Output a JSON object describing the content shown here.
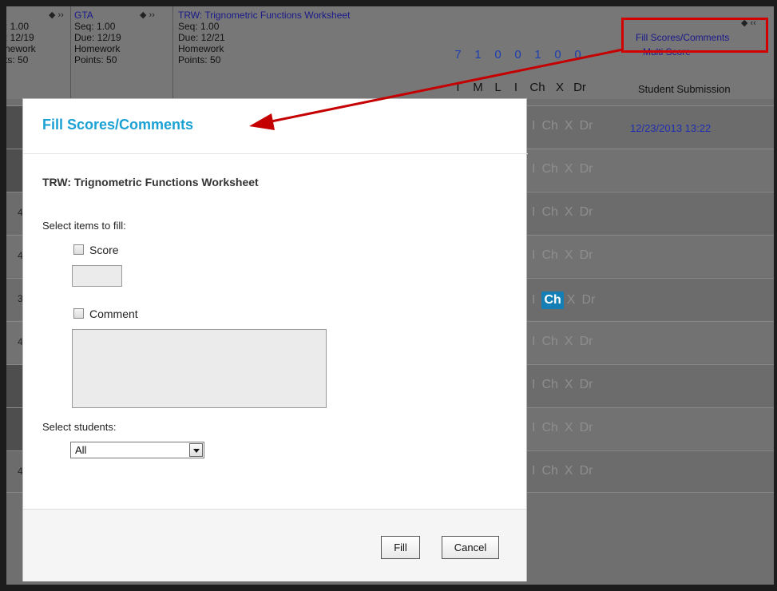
{
  "gradebook": {
    "columns": [
      {
        "title": "",
        "seq": ": 1.00",
        "due": ": 12/19",
        "category": "nework",
        "points": "ts: 50"
      },
      {
        "title": "GTA",
        "seq": "Seq: 1.00",
        "due": "Due: 12/19",
        "category": "Homework",
        "points": "Points: 50"
      },
      {
        "title": "TRW: Trignometric Functions Worksheet",
        "seq": "Seq: 1.00",
        "due": "Due: 12/21",
        "category": "Homework",
        "points": "Points: 50"
      }
    ],
    "counts": [
      "7",
      "1",
      "0",
      "0",
      "1",
      "0",
      "0"
    ],
    "code_headers": [
      "T",
      "M",
      "L",
      "I",
      "Ch",
      "X",
      "Dr"
    ],
    "submission_header": "Student Submission",
    "fill_link": "Fill Scores/Comments",
    "multi_link": "Multi Score",
    "rows": [
      {
        "num": "",
        "codes": [
          "I",
          "Ch",
          "X",
          "Dr"
        ],
        "selected": "",
        "submission": "12/23/2013 13:22"
      },
      {
        "num": "",
        "codes": [
          "I",
          "Ch",
          "X",
          "Dr"
        ],
        "selected": "",
        "submission": ""
      },
      {
        "num": "4",
        "codes": [
          "I",
          "Ch",
          "X",
          "Dr"
        ],
        "selected": "",
        "submission": ""
      },
      {
        "num": "4",
        "codes": [
          "I",
          "Ch",
          "X",
          "Dr"
        ],
        "selected": "",
        "submission": ""
      },
      {
        "num": "3",
        "codes": [
          "I",
          "Ch",
          "X",
          "Dr"
        ],
        "selected": "Ch",
        "submission": ""
      },
      {
        "num": "4",
        "codes": [
          "I",
          "Ch",
          "X",
          "Dr"
        ],
        "selected": "",
        "submission": ""
      },
      {
        "num": "",
        "codes": [
          "I",
          "Ch",
          "X",
          "Dr"
        ],
        "selected": "",
        "submission": ""
      },
      {
        "num": "",
        "codes": [
          "I",
          "Ch",
          "X",
          "Dr"
        ],
        "selected": "",
        "submission": ""
      },
      {
        "num": "4",
        "codes": [
          "I",
          "Ch",
          "X",
          "Dr"
        ],
        "selected": "",
        "submission": ""
      }
    ]
  },
  "modal": {
    "title": "Fill Scores/Comments",
    "assignment": "TRW: Trignometric Functions Worksheet",
    "select_items_label": "Select items to fill:",
    "score_label": "Score",
    "score_value": "",
    "comment_label": "Comment",
    "comment_value": "",
    "select_students_label": "Select students:",
    "students_selected": "All",
    "fill_button": "Fill",
    "cancel_button": "Cancel"
  },
  "colors": {
    "accent": "#1ba1d4",
    "callout": "#d30000",
    "selected_code": "#157fb5",
    "link": "#1a1a8c"
  }
}
